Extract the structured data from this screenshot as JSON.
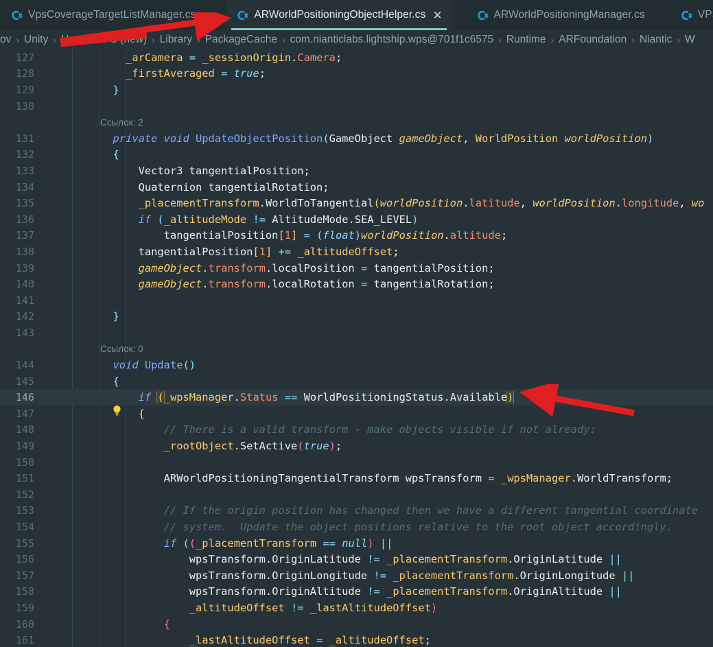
{
  "window": {
    "theme_bg": "#263238",
    "accent": "#80cbc4",
    "annotation_color": "#e02020"
  },
  "tabbar": {
    "tabs": [
      {
        "label": "VpsCoverageTargetListManager.cs",
        "icon": "csharp-file-icon",
        "active": false,
        "closable": false
      },
      {
        "label": "ARWorldPositioningObjectHelper.cs",
        "icon": "csharp-file-icon",
        "active": true,
        "closable": true,
        "close_label": "✕"
      },
      {
        "label": "ARWorldPositioningManager.cs",
        "icon": "csharp-file-icon",
        "active": false,
        "closable": false
      },
      {
        "label": "VPSLocal",
        "icon": "csharp-file-icon",
        "active": false,
        "closable": false
      }
    ]
  },
  "breadcrumb": {
    "separator": "›",
    "items": [
      {
        "label": "ov",
        "redacted": false
      },
      {
        "label": "Unity",
        "redacted": false
      },
      {
        "label": "Hawaii VPS (new)",
        "redacted": true
      },
      {
        "label": "Library",
        "redacted": false
      },
      {
        "label": "PackageCache",
        "redacted": false
      },
      {
        "label": "com.nianticlabs.lightship.wps@701f1c6575",
        "redacted": false
      },
      {
        "label": "Runtime",
        "redacted": false
      },
      {
        "label": "ARFoundation",
        "redacted": false
      },
      {
        "label": "Niantic",
        "redacted": false
      },
      {
        "label": "W",
        "redacted": false
      }
    ]
  },
  "editor": {
    "codelens_refs_2": "Ссылок: 2",
    "codelens_refs_0": "Ссылок: 0",
    "lightbulb_icon": "lightbulb-quickfix-icon",
    "highlighted_line": 146,
    "lines": [
      {
        "n": "127",
        "text": "            _arCamera = _sessionOrigin.Camera;"
      },
      {
        "n": "128",
        "text": "            _firstAveraged = true;"
      },
      {
        "n": "129",
        "text": "        }"
      },
      {
        "n": "130",
        "text": ""
      },
      {
        "n": "",
        "text": "Ссылок: 2"
      },
      {
        "n": "131",
        "text": "        private void UpdateObjectPosition(GameObject gameObject, WorldPosition worldPosition)"
      },
      {
        "n": "132",
        "text": "        {"
      },
      {
        "n": "133",
        "text": "            Vector3 tangentialPosition;"
      },
      {
        "n": "134",
        "text": "            Quaternion tangentialRotation;"
      },
      {
        "n": "135",
        "text": "            _placementTransform.WorldToTangential(worldPosition.latitude, worldPosition.longitude, wo"
      },
      {
        "n": "136",
        "text": "            if (_altitudeMode != AltitudeMode.SEA_LEVEL)"
      },
      {
        "n": "137",
        "text": "                tangentialPosition[1] = (float)worldPosition.altitude;"
      },
      {
        "n": "138",
        "text": "            tangentialPosition[1] += _altitudeOffset;"
      },
      {
        "n": "139",
        "text": "            gameObject.transform.localPosition = tangentialPosition;"
      },
      {
        "n": "140",
        "text": "            gameObject.transform.localRotation = tangentialRotation;"
      },
      {
        "n": "141",
        "text": ""
      },
      {
        "n": "142",
        "text": "        }"
      },
      {
        "n": "143",
        "text": ""
      },
      {
        "n": "",
        "text": "Ссылок: 0"
      },
      {
        "n": "144",
        "text": "        void Update()"
      },
      {
        "n": "145",
        "text": "        {"
      },
      {
        "n": "146",
        "text": "            if (_wpsManager.Status == WorldPositioningStatus.Available)"
      },
      {
        "n": "147",
        "text": "            {"
      },
      {
        "n": "148",
        "text": "                // There is a valid transform - make objects visible if not already:"
      },
      {
        "n": "149",
        "text": "                _rootObject.SetActive(true);"
      },
      {
        "n": "150",
        "text": ""
      },
      {
        "n": "151",
        "text": "                ARWorldPositioningTangentialTransform wpsTransform = _wpsManager.WorldTransform;"
      },
      {
        "n": "152",
        "text": ""
      },
      {
        "n": "153",
        "text": "                // If the origin position has changed then we have a different tangential coordinate"
      },
      {
        "n": "154",
        "text": "                // system.  Update the object positions relative to the root object accordingly."
      },
      {
        "n": "155",
        "text": "                if ((_placementTransform == null) ||"
      },
      {
        "n": "156",
        "text": "                    wpsTransform.OriginLatitude != _placementTransform.OriginLatitude ||"
      },
      {
        "n": "157",
        "text": "                    wpsTransform.OriginLongitude != _placementTransform.OriginLongitude ||"
      },
      {
        "n": "158",
        "text": "                    wpsTransform.OriginAltitude != _placementTransform.OriginAltitude ||"
      },
      {
        "n": "159",
        "text": "                    _altitudeOffset != _lastAltitudeOffset)"
      },
      {
        "n": "160",
        "text": "                {"
      },
      {
        "n": "161",
        "text": "                    _lastAltitudeOffset = _altitudeOffset;"
      }
    ]
  },
  "annotations": {
    "arrow_to_active_tab": "red-arrow-pointing-to-active-tab",
    "arrow_to_line_146": "red-arrow-pointing-to-if-statement",
    "redaction_bar": "red-redaction-over-breadcrumb-item"
  }
}
